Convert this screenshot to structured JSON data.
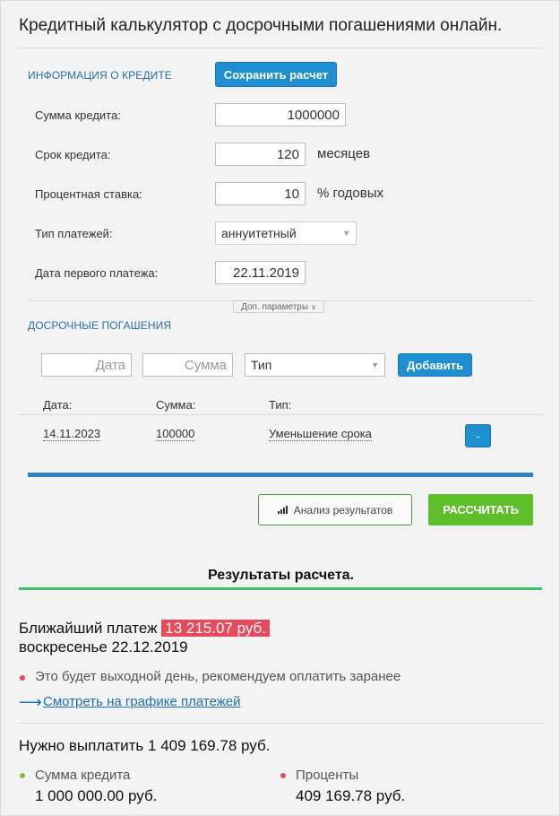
{
  "page_title": "Кредитный калькулятор с досрочными погашениями онлайн.",
  "credit_info": {
    "section_label": "ИНФОРМАЦИЯ О КРЕДИТЕ",
    "save_button": "Сохранить расчет",
    "amount_label": "Сумма кредита:",
    "amount_value": "1000000",
    "term_label": "Срок кредита:",
    "term_value": "120",
    "term_unit": "месяцев",
    "rate_label": "Процентная ставка:",
    "rate_value": "10",
    "rate_unit": "% годовых",
    "payment_type_label": "Тип платежей:",
    "payment_type_value": "аннуитетный",
    "first_payment_label": "Дата первого платежа:",
    "first_payment_value": "22.11.2019",
    "extra_params": "Доп. параметры"
  },
  "early_repayments": {
    "section_label": "ДОСРОЧНЫЕ ПОГАШЕНИЯ",
    "date_placeholder": "Дата",
    "sum_placeholder": "Сумма",
    "type_placeholder": "Тип",
    "add_button": "Добавить",
    "columns": [
      "Дата:",
      "Сумма:",
      "Тип:"
    ],
    "rows": [
      {
        "date": "14.11.2023",
        "sum": "100000",
        "type": "Уменьшение срока",
        "remove": "-"
      }
    ]
  },
  "actions": {
    "analysis_button": "Анализ результатов",
    "calculate_button": "РАССЧИТАТЬ"
  },
  "results": {
    "title": "Результаты расчета.",
    "next_payment_prefix": "Ближайший платеж",
    "next_payment_amount": "13 215.07 руб.",
    "next_payment_date": "воскресенье 22.12.2019",
    "weekend_note": "Это будет выходной день, рекомендуем оплатить заранее",
    "schedule_link": "Смотреть на графике платежей",
    "total_label": "Нужно выплатить 1 409 169.78 руб.",
    "principal_label": "Сумма кредита",
    "principal_value": "1 000 000.00 руб.",
    "interest_label": "Проценты",
    "interest_value": "409 169.78 руб."
  },
  "colors": {
    "accent_blue": "#1f8fd1",
    "green": "#5fbf2a",
    "red": "#e94a5b",
    "link": "#1f6fb8"
  }
}
